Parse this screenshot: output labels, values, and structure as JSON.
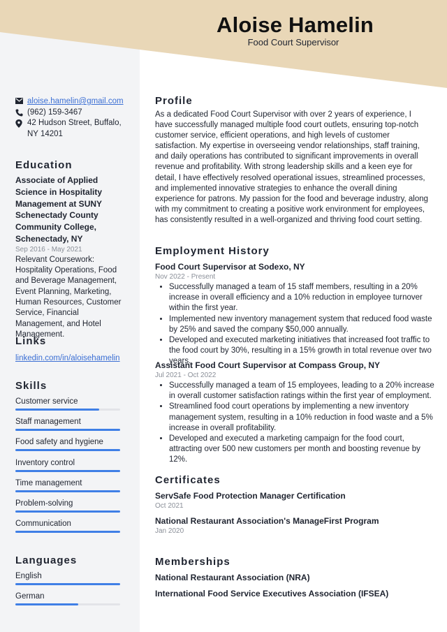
{
  "header": {
    "name": "Aloise Hamelin",
    "title": "Food Court Supervisor",
    "accent_color": "#e9d7b7"
  },
  "contact": {
    "email": "aloise.hamelin@gmail.com",
    "phone": "(962) 159-3467",
    "address": "42 Hudson Street, Buffalo, NY 14201",
    "icons": [
      "envelope-icon",
      "phone-icon",
      "location-pin-icon"
    ]
  },
  "education": {
    "heading": "Education",
    "degree": "Associate of Applied Science in Hospitality Management at SUNY Schenectady County Community College, Schenectady, NY",
    "dates": "Sep 2016 - May 2021",
    "coursework": "Relevant Coursework: Hospitality Operations, Food and Beverage Management, Event Planning, Marketing, Human Resources, Customer Service, Financial Management, and Hotel Management."
  },
  "links": {
    "heading": "Links",
    "items": [
      "linkedin.com/in/aloisehamelin"
    ]
  },
  "skills": {
    "heading": "Skills",
    "items": [
      {
        "label": "Customer service",
        "level": 0.8
      },
      {
        "label": "Staff management",
        "level": 1.0
      },
      {
        "label": "Food safety and hygiene",
        "level": 1.0
      },
      {
        "label": "Inventory control",
        "level": 1.0
      },
      {
        "label": "Time management",
        "level": 1.0
      },
      {
        "label": "Problem-solving",
        "level": 1.0
      },
      {
        "label": "Communication",
        "level": 1.0
      }
    ]
  },
  "languages": {
    "heading": "Languages",
    "items": [
      {
        "label": "English",
        "level": 1.0
      },
      {
        "label": "German",
        "level": 0.6
      }
    ]
  },
  "profile": {
    "heading": "Profile",
    "text": "As a dedicated Food Court Supervisor with over 2 years of experience, I have successfully managed multiple food court outlets, ensuring top-notch customer service, efficient operations, and high levels of customer satisfaction. My expertise in overseeing vendor relationships, staff training, and daily operations has contributed to significant improvements in overall revenue and profitability. With strong leadership skills and a keen eye for detail, I have effectively resolved operational issues, streamlined processes, and implemented innovative strategies to enhance the overall dining experience for patrons. My passion for the food and beverage industry, along with my commitment to creating a positive work environment for employees, has consistently resulted in a well-organized and thriving food court setting."
  },
  "employment": {
    "heading": "Employment History",
    "jobs": [
      {
        "title": "Food Court Supervisor at Sodexo, NY",
        "dates": "Nov 2022 - Present",
        "bullets": [
          "Successfully managed a team of 15 staff members, resulting in a 20% increase in overall efficiency and a 10% reduction in employee turnover within the first year.",
          "Implemented new inventory management system that reduced food waste by 25% and saved the company $50,000 annually.",
          "Developed and executed marketing initiatives that increased foot traffic to the food court by 30%, resulting in a 15% growth in total revenue over two years."
        ]
      },
      {
        "title": "Assistant Food Court Supervisor at Compass Group, NY",
        "dates": "Jul 2021 - Oct 2022",
        "bullets": [
          "Successfully managed a team of 15 employees, leading to a 20% increase in overall customer satisfaction ratings within the first year of employment.",
          "Streamlined food court operations by implementing a new inventory management system, resulting in a 10% reduction in food waste and a 5% increase in overall profitability.",
          "Developed and executed a marketing campaign for the food court, attracting over 500 new customers per month and boosting revenue by 12%."
        ]
      }
    ]
  },
  "certificates": {
    "heading": "Certificates",
    "items": [
      {
        "title": "ServSafe Food Protection Manager Certification",
        "date": "Oct 2021"
      },
      {
        "title": "National Restaurant Association's ManageFirst Program",
        "date": "Jan 2020"
      }
    ]
  },
  "memberships": {
    "heading": "Memberships",
    "items": [
      "National Restaurant Association (NRA)",
      "International Food Service Executives Association (IFSEA)"
    ]
  }
}
